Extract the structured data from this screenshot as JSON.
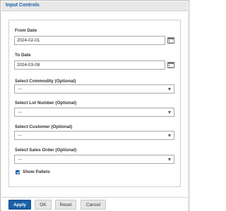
{
  "dialog": {
    "title": "Input Controls"
  },
  "fields": {
    "from_date": {
      "label": "From Date",
      "value": "2024-02-01"
    },
    "to_date": {
      "label": "To Date",
      "value": "2024-03-08"
    },
    "commodity": {
      "label": "Select Commodity (Optional)",
      "value": "---"
    },
    "lot_number": {
      "label": "Select Lot Number (Optional)",
      "value": "---"
    },
    "customer": {
      "label": "Select Customer (Optional)",
      "value": "---"
    },
    "sales_order": {
      "label": "Select Sales Order (Optional)",
      "value": "---"
    },
    "show_pallets": {
      "label": "Show Pallets",
      "checked": true
    }
  },
  "buttons": {
    "apply": "Apply",
    "ok": "OK",
    "reset": "Reset",
    "cancel": "Cancel"
  },
  "colors": {
    "accent": "#1a5fa8"
  }
}
